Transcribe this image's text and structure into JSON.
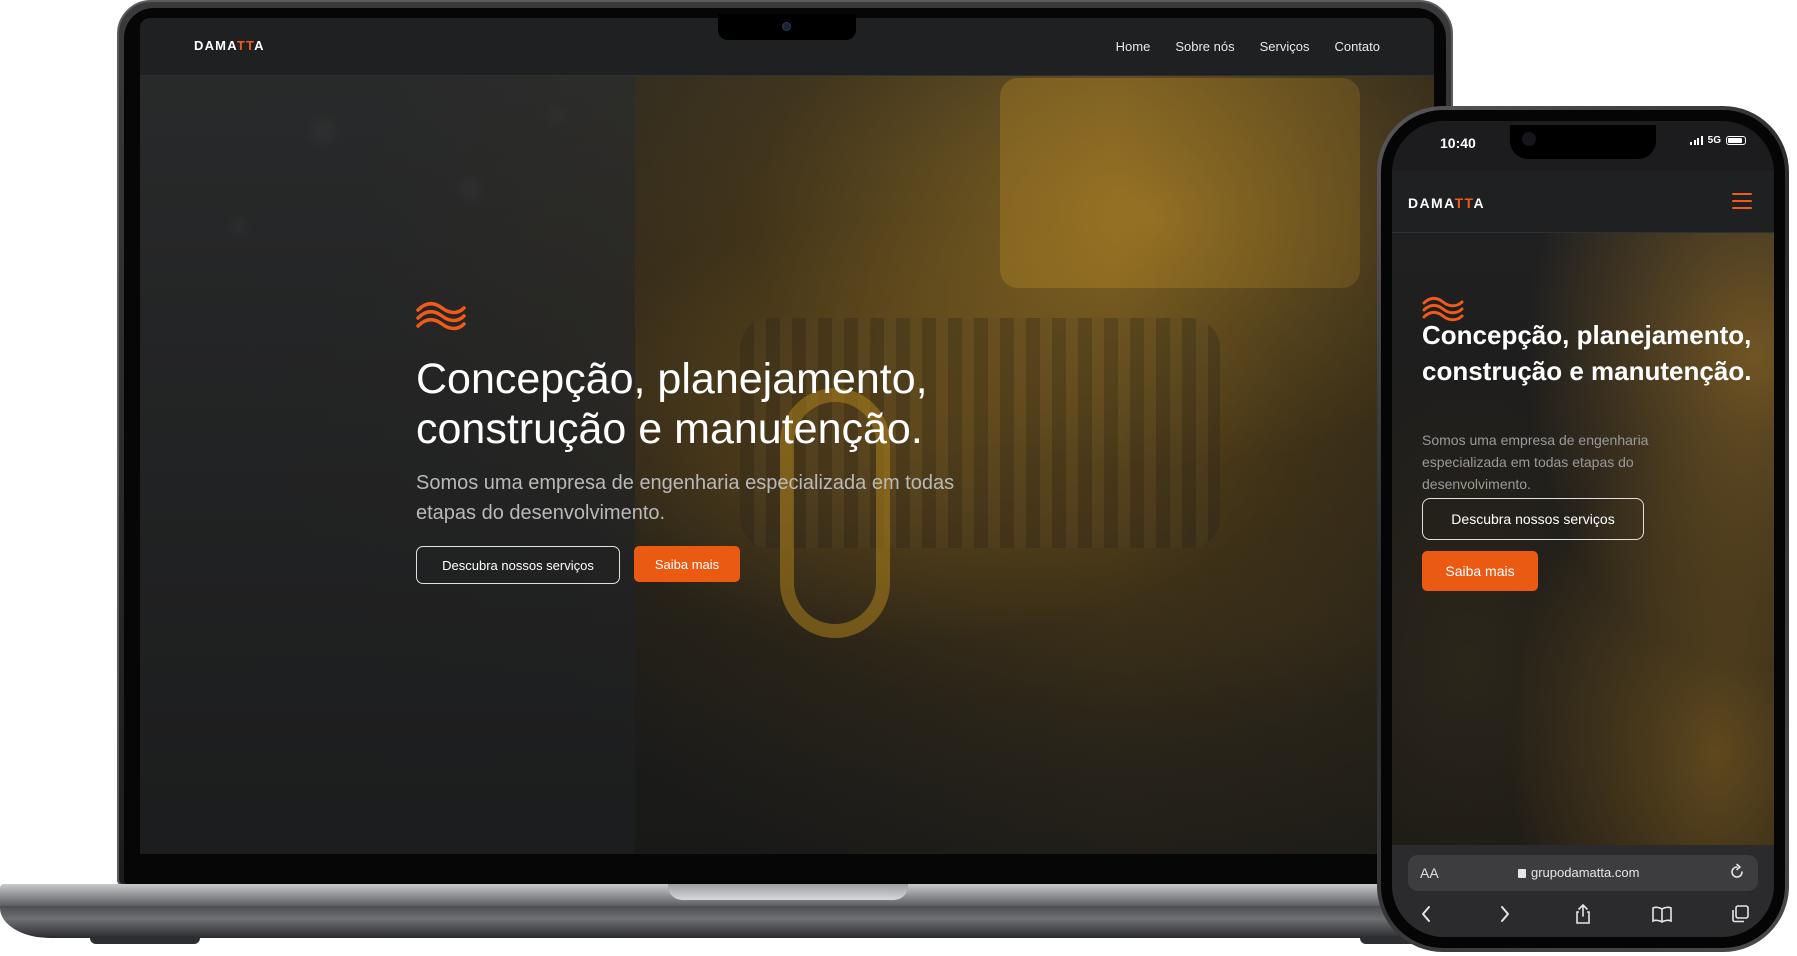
{
  "laptop": {
    "brand": {
      "prefix": "DAMA",
      "accent": "TT",
      "suffix": "A"
    },
    "nav": [
      {
        "label": "Home"
      },
      {
        "label": "Sobre nós"
      },
      {
        "label": "Serviços"
      },
      {
        "label": "Contato"
      }
    ],
    "hero": {
      "title": "Concepção, planejamento, construção e manutenção.",
      "subtitle": "Somos uma empresa de engenharia especializada em todas etapas do desenvolvimento.",
      "cta_secondary": "Descubra nossos serviços",
      "cta_primary": "Saiba mais"
    }
  },
  "phone": {
    "status": {
      "time": "10:40",
      "network": "5G"
    },
    "brand": {
      "prefix": "DAMA",
      "accent": "TT",
      "suffix": "A"
    },
    "hero": {
      "title": "Concepção, planejamento, construção e manutenção.",
      "subtitle": "Somos uma empresa de engenharia especializada em todas etapas do desenvolvimento.",
      "cta_secondary": "Descubra nossos serviços",
      "cta_primary": "Saiba mais"
    },
    "browser": {
      "text_size_label": "AA",
      "url": "grupodamatta.com"
    }
  },
  "theme": {
    "accent": "#ea5a12",
    "nav_bg": "#1f2022",
    "text": "#ffffff"
  },
  "icons": [
    "brand-waves-icon",
    "hamburger-menu-icon",
    "lock-icon",
    "reload-icon",
    "back-icon",
    "forward-icon",
    "share-icon",
    "bookmarks-icon",
    "tabs-icon",
    "camera-icon"
  ]
}
